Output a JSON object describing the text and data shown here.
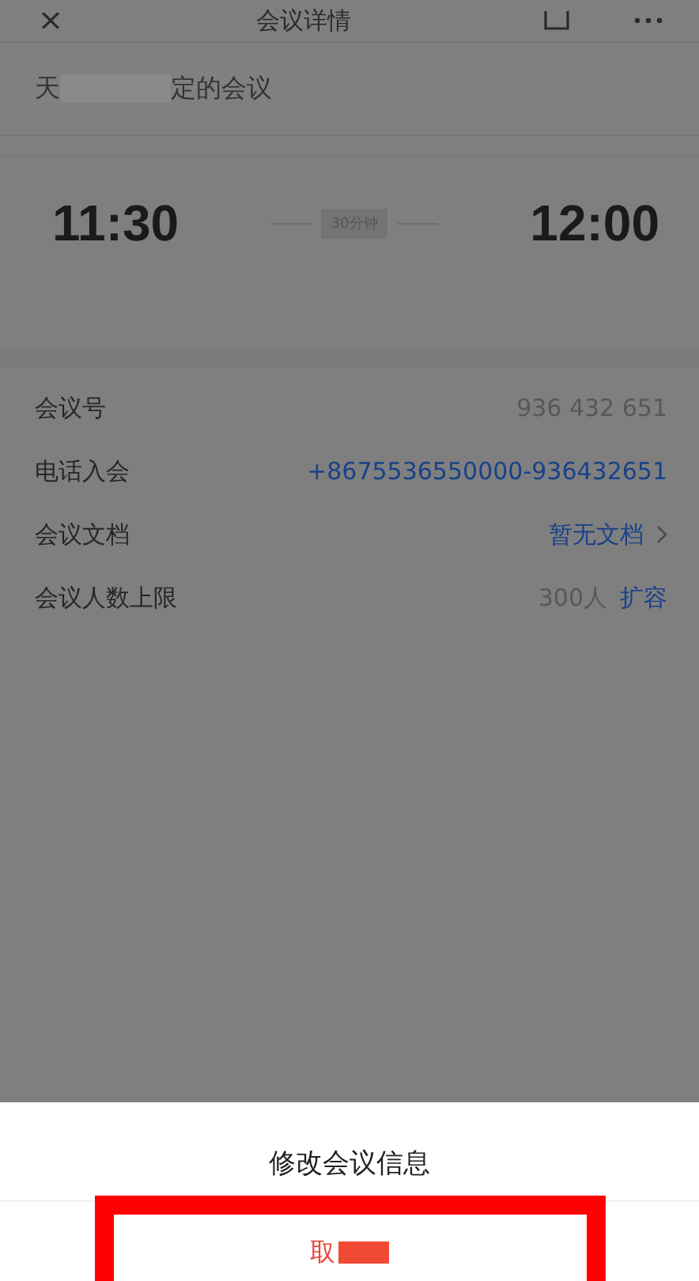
{
  "header": {
    "title": "会议详情"
  },
  "organizer": {
    "parts": [
      {
        "kind": "text",
        "text": "天"
      },
      {
        "kind": "redaction"
      },
      {
        "kind": "text",
        "text": "定的会议"
      }
    ]
  },
  "time": {
    "start": "11:30",
    "duration": "30分钟",
    "end": "12:00"
  },
  "rows": [
    {
      "kind": "plain",
      "label": "会议号",
      "value": "936 432 651"
    },
    {
      "kind": "link",
      "label": "电话入会",
      "value": "+8675536550000-936432651"
    },
    {
      "kind": "chevron",
      "label": "会议文档",
      "value": "暂无文档"
    },
    {
      "kind": "action",
      "label": "会议人数上限",
      "value": "300人",
      "action": "扩容"
    }
  ],
  "sheet": {
    "title": "修改会议信息",
    "cancel_highlighted": true,
    "cancel_parts": [
      {
        "kind": "text",
        "text": "取"
      },
      {
        "kind": "redaction"
      }
    ]
  }
}
